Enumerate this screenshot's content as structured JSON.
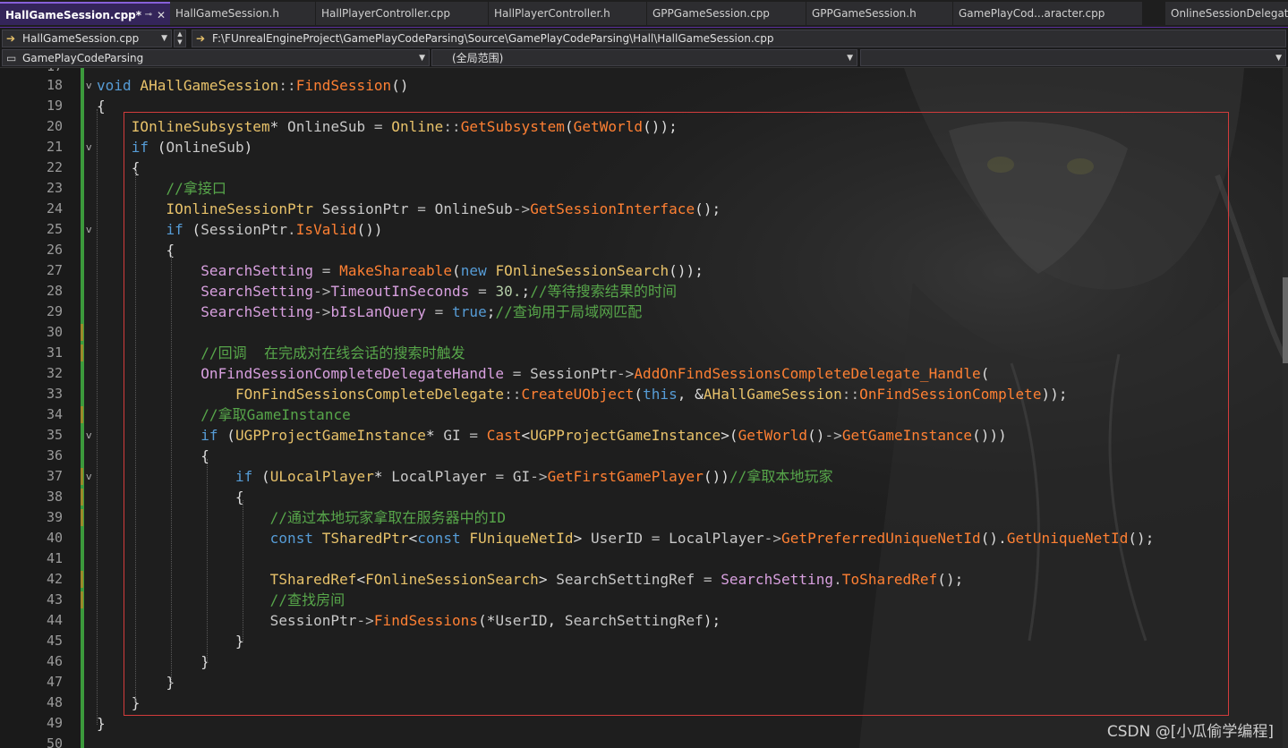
{
  "tabs": [
    {
      "label": "HallGameSession.cpp*",
      "active": true
    },
    {
      "label": "HallGameSession.h"
    },
    {
      "label": "HallPlayerController.cpp"
    },
    {
      "label": "HallPlayerController.h"
    },
    {
      "label": "GPPGameSession.cpp"
    },
    {
      "label": "GPPGameSession.h"
    },
    {
      "label": "GamePlayCod...aracter.cpp"
    },
    {
      "label": "OnlineSessionDelegate"
    }
  ],
  "navbar": {
    "file_combo": "HallGameSession.cpp",
    "path": "F:\\FUnrealEngineProject\\GamePlayCodeParsing\\Source\\GamePlayCodeParsing\\Hall\\HallGameSession.cpp",
    "project_combo": "GamePlayCodeParsing",
    "scope_combo": "(全局范围)",
    "member_combo": ""
  },
  "editor": {
    "partial_top_line": "17",
    "lines": [
      {
        "n": "18",
        "fold": "v",
        "tokens": [
          [
            "kw",
            "void"
          ],
          [
            "pu",
            " "
          ],
          [
            "ty",
            "AHallGameSession"
          ],
          [
            "op",
            "::"
          ],
          [
            "fn",
            "FindSession"
          ],
          [
            "pu",
            "()"
          ]
        ]
      },
      {
        "n": "19",
        "tokens": [
          [
            "pu",
            "{"
          ]
        ]
      },
      {
        "n": "20",
        "tokens": [
          [
            "pu",
            "    "
          ],
          [
            "ty",
            "IOnlineSubsystem"
          ],
          [
            "pu",
            "* "
          ],
          [
            "id",
            "OnlineSub"
          ],
          [
            "op",
            " = "
          ],
          [
            "ty",
            "Online"
          ],
          [
            "op",
            "::"
          ],
          [
            "fn",
            "GetSubsystem"
          ],
          [
            "pu",
            "("
          ],
          [
            "fn",
            "GetWorld"
          ],
          [
            "pu",
            "());"
          ]
        ]
      },
      {
        "n": "21",
        "fold": "v",
        "tokens": [
          [
            "pu",
            "    "
          ],
          [
            "kw",
            "if"
          ],
          [
            "pu",
            " ("
          ],
          [
            "id",
            "OnlineSub"
          ],
          [
            "pu",
            ")"
          ]
        ]
      },
      {
        "n": "22",
        "tokens": [
          [
            "pu",
            "    {"
          ]
        ]
      },
      {
        "n": "23",
        "tokens": [
          [
            "pu",
            "        "
          ],
          [
            "cm",
            "//拿接口"
          ]
        ]
      },
      {
        "n": "24",
        "tokens": [
          [
            "pu",
            "        "
          ],
          [
            "ty",
            "IOnlineSessionPtr"
          ],
          [
            "pu",
            " "
          ],
          [
            "id",
            "SessionPtr"
          ],
          [
            "op",
            " = "
          ],
          [
            "id",
            "OnlineSub"
          ],
          [
            "op",
            "->"
          ],
          [
            "fn",
            "GetSessionInterface"
          ],
          [
            "pu",
            "();"
          ]
        ]
      },
      {
        "n": "25",
        "fold": "v",
        "tokens": [
          [
            "pu",
            "        "
          ],
          [
            "kw",
            "if"
          ],
          [
            "pu",
            " ("
          ],
          [
            "id",
            "SessionPtr"
          ],
          [
            "op",
            "."
          ],
          [
            "fn",
            "IsValid"
          ],
          [
            "pu",
            "())"
          ]
        ]
      },
      {
        "n": "26",
        "tokens": [
          [
            "pu",
            "        {"
          ]
        ]
      },
      {
        "n": "27",
        "tokens": [
          [
            "pu",
            "            "
          ],
          [
            "mb",
            "SearchSetting"
          ],
          [
            "op",
            " = "
          ],
          [
            "fn",
            "MakeShareable"
          ],
          [
            "pu",
            "("
          ],
          [
            "kw",
            "new"
          ],
          [
            "pu",
            " "
          ],
          [
            "ty",
            "FOnlineSessionSearch"
          ],
          [
            "pu",
            "());"
          ]
        ]
      },
      {
        "n": "28",
        "tokens": [
          [
            "pu",
            "            "
          ],
          [
            "mb",
            "SearchSetting"
          ],
          [
            "op",
            "->"
          ],
          [
            "mb",
            "TimeoutInSeconds"
          ],
          [
            "op",
            " = "
          ],
          [
            "nu",
            "30."
          ],
          [
            "pu",
            ";"
          ],
          [
            "cm",
            "//等待搜索结果的时间"
          ]
        ]
      },
      {
        "n": "29",
        "tokens": [
          [
            "pu",
            "            "
          ],
          [
            "mb",
            "SearchSetting"
          ],
          [
            "op",
            "->"
          ],
          [
            "mb",
            "bIsLanQuery"
          ],
          [
            "op",
            " = "
          ],
          [
            "kw",
            "true"
          ],
          [
            "pu",
            ";"
          ],
          [
            "cm",
            "//查询用于局域网匹配"
          ]
        ]
      },
      {
        "n": "30",
        "mark": true,
        "tokens": []
      },
      {
        "n": "31",
        "mark": true,
        "tokens": [
          [
            "pu",
            "            "
          ],
          [
            "cm",
            "//回调  在完成对在线会话的搜索时触发"
          ]
        ]
      },
      {
        "n": "32",
        "tokens": [
          [
            "pu",
            "            "
          ],
          [
            "mb",
            "OnFindSessionCompleteDelegateHandle"
          ],
          [
            "op",
            " = "
          ],
          [
            "id",
            "SessionPtr"
          ],
          [
            "op",
            "->"
          ],
          [
            "fn",
            "AddOnFindSessionsCompleteDelegate_Handle"
          ],
          [
            "pu",
            "("
          ]
        ]
      },
      {
        "n": "33",
        "tokens": [
          [
            "pu",
            "                "
          ],
          [
            "ty",
            "FOnFindSessionsCompleteDelegate"
          ],
          [
            "op",
            "::"
          ],
          [
            "fn",
            "CreateUObject"
          ],
          [
            "pu",
            "("
          ],
          [
            "kw",
            "this"
          ],
          [
            "pu",
            ", &"
          ],
          [
            "ty",
            "AHallGameSession"
          ],
          [
            "op",
            "::"
          ],
          [
            "fn",
            "OnFindSessionComplete"
          ],
          [
            "pu",
            "));"
          ]
        ]
      },
      {
        "n": "34",
        "mark": true,
        "tokens": [
          [
            "pu",
            "            "
          ],
          [
            "cm",
            "//拿取GameInstance"
          ]
        ]
      },
      {
        "n": "35",
        "fold": "v",
        "tokens": [
          [
            "pu",
            "            "
          ],
          [
            "kw",
            "if"
          ],
          [
            "pu",
            " ("
          ],
          [
            "ty",
            "UGPProjectGameInstance"
          ],
          [
            "pu",
            "* "
          ],
          [
            "id",
            "GI"
          ],
          [
            "op",
            " = "
          ],
          [
            "fn",
            "Cast"
          ],
          [
            "pu",
            "<"
          ],
          [
            "ty",
            "UGPProjectGameInstance"
          ],
          [
            "pu",
            ">("
          ],
          [
            "fn",
            "GetWorld"
          ],
          [
            "pu",
            "()"
          ],
          [
            "op",
            "->"
          ],
          [
            "fn",
            "GetGameInstance"
          ],
          [
            "pu",
            "()))"
          ]
        ]
      },
      {
        "n": "36",
        "tokens": [
          [
            "pu",
            "            {"
          ]
        ]
      },
      {
        "n": "37",
        "fold": "v",
        "mark": true,
        "tokens": [
          [
            "pu",
            "                "
          ],
          [
            "kw",
            "if"
          ],
          [
            "pu",
            " ("
          ],
          [
            "ty",
            "ULocalPlayer"
          ],
          [
            "pu",
            "* "
          ],
          [
            "id",
            "LocalPlayer"
          ],
          [
            "op",
            " = "
          ],
          [
            "id",
            "GI"
          ],
          [
            "op",
            "->"
          ],
          [
            "fn",
            "GetFirstGamePlayer"
          ],
          [
            "pu",
            "())"
          ],
          [
            "cm",
            "//拿取本地玩家"
          ]
        ]
      },
      {
        "n": "38",
        "mark": true,
        "tokens": [
          [
            "pu",
            "                {"
          ]
        ]
      },
      {
        "n": "39",
        "mark": true,
        "tokens": [
          [
            "pu",
            "                    "
          ],
          [
            "cm",
            "//通过本地玩家拿取在服务器中的ID"
          ]
        ]
      },
      {
        "n": "40",
        "tokens": [
          [
            "pu",
            "                    "
          ],
          [
            "kw",
            "const"
          ],
          [
            "pu",
            " "
          ],
          [
            "ty",
            "TSharedPtr"
          ],
          [
            "pu",
            "<"
          ],
          [
            "kw",
            "const"
          ],
          [
            "pu",
            " "
          ],
          [
            "ty",
            "FUniqueNetId"
          ],
          [
            "pu",
            "> "
          ],
          [
            "id",
            "UserID"
          ],
          [
            "op",
            " = "
          ],
          [
            "id",
            "LocalPlayer"
          ],
          [
            "op",
            "->"
          ],
          [
            "fn",
            "GetPreferredUniqueNetId"
          ],
          [
            "pu",
            "()."
          ],
          [
            "fn",
            "GetUniqueNetId"
          ],
          [
            "pu",
            "();"
          ]
        ]
      },
      {
        "n": "41",
        "tokens": []
      },
      {
        "n": "42",
        "mark": true,
        "tokens": [
          [
            "pu",
            "                    "
          ],
          [
            "ty",
            "TSharedRef"
          ],
          [
            "pu",
            "<"
          ],
          [
            "ty",
            "FOnlineSessionSearch"
          ],
          [
            "pu",
            "> "
          ],
          [
            "id",
            "SearchSettingRef"
          ],
          [
            "op",
            " = "
          ],
          [
            "mb",
            "SearchSetting"
          ],
          [
            "op",
            "."
          ],
          [
            "fn",
            "ToSharedRef"
          ],
          [
            "pu",
            "();"
          ]
        ]
      },
      {
        "n": "43",
        "mark": true,
        "tokens": [
          [
            "pu",
            "                    "
          ],
          [
            "cm",
            "//查找房间"
          ]
        ]
      },
      {
        "n": "44",
        "tokens": [
          [
            "pu",
            "                    "
          ],
          [
            "id",
            "SessionPtr"
          ],
          [
            "op",
            "->"
          ],
          [
            "fn",
            "FindSessions"
          ],
          [
            "pu",
            "(*"
          ],
          [
            "id",
            "UserID"
          ],
          [
            "pu",
            ", "
          ],
          [
            "id",
            "SearchSettingRef"
          ],
          [
            "pu",
            ");"
          ]
        ]
      },
      {
        "n": "45",
        "tokens": [
          [
            "pu",
            "                }"
          ]
        ]
      },
      {
        "n": "46",
        "tokens": [
          [
            "pu",
            "            }"
          ]
        ]
      },
      {
        "n": "47",
        "tokens": [
          [
            "pu",
            "        }"
          ]
        ]
      },
      {
        "n": "48",
        "tokens": [
          [
            "pu",
            "    }"
          ]
        ]
      },
      {
        "n": "49",
        "tokens": [
          [
            "pu",
            "}"
          ]
        ]
      },
      {
        "n": "50",
        "tokens": []
      }
    ]
  },
  "colors": {
    "keyword": "#569cd6",
    "type": "#e8c26a",
    "function": "#ff8033",
    "comment": "#57a64a",
    "member": "#d8a0df",
    "number": "#b5cea8",
    "highlight_box": "#d23c3c",
    "active_tab": "#34255a"
  },
  "icons": {
    "file_nav": "arrow-right-icon",
    "close": "close-icon",
    "pin": "pin-icon",
    "dropdown": "chevron-down-icon",
    "fold": "collapse-chevron-icon"
  },
  "watermark": "CSDN @[小瓜偷学编程]"
}
